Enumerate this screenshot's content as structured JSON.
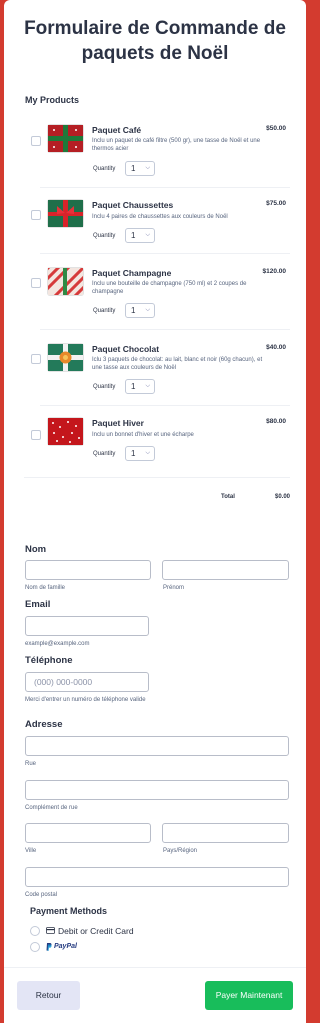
{
  "form": {
    "title": "Formulaire de Commande de paquets de Noël",
    "products_label": "My Products"
  },
  "colors": {
    "background": "#d33b2f",
    "pay_button": "#18bd5b",
    "back_button": "#e3e5f5"
  },
  "products": [
    {
      "name": "Paquet Café",
      "price": "$50.00",
      "desc": "Inclu un paquet de café filtre (500 gr), une tasse de Noël et une thermos acier",
      "qty_label": "Quantity",
      "qty": "1",
      "thumb": "red-gift-green-ribbon"
    },
    {
      "name": "Paquet Chaussettes",
      "price": "$75.00",
      "desc": "Inclu 4 paires de chaussettes aux couleurs de Noël",
      "qty_label": "Quantity",
      "qty": "1",
      "thumb": "green-gift-red-ribbon"
    },
    {
      "name": "Paquet Champagne",
      "price": "$120.00",
      "desc": "Inclu une bouteille de champagne (750 ml) et 2 coupes de champagne",
      "qty_label": "Quantity",
      "qty": "1",
      "thumb": "striped-gift"
    },
    {
      "name": "Paquet Chocolat",
      "price": "$40.00",
      "desc": "Iclu 3 paquets de chocolat: au lait, blanc et noir (60g chacun), et une tasse aux couleurs de Noël",
      "qty_label": "Quantity",
      "qty": "1",
      "thumb": "green-gift-ornament"
    },
    {
      "name": "Paquet Hiver",
      "price": "$80.00",
      "desc": "Inclu un bonnet d'hiver et une écharpe",
      "qty_label": "Quantity",
      "qty": "1",
      "thumb": "red-dotted-gift"
    }
  ],
  "total": {
    "label": "Total",
    "value": "$0.00"
  },
  "nom": {
    "title": "Nom",
    "last_sub": "Nom de famille",
    "first_sub": "Prénom"
  },
  "email": {
    "title": "Email",
    "sub": "example@example.com"
  },
  "phone": {
    "title": "Téléphone",
    "placeholder": "(000) 000-0000",
    "sub": "Merci d'entrer un numéro de téléphone valide"
  },
  "address": {
    "title": "Adresse",
    "street": "Rue",
    "street2": "Complément de rue",
    "city": "Ville",
    "country": "Pays/Région",
    "zip": "Code postal"
  },
  "payment": {
    "title": "Payment Methods",
    "card": "Debit or Credit Card",
    "paypal": "PayPal"
  },
  "footer": {
    "back": "Retour",
    "pay": "Payer Maintenant"
  }
}
